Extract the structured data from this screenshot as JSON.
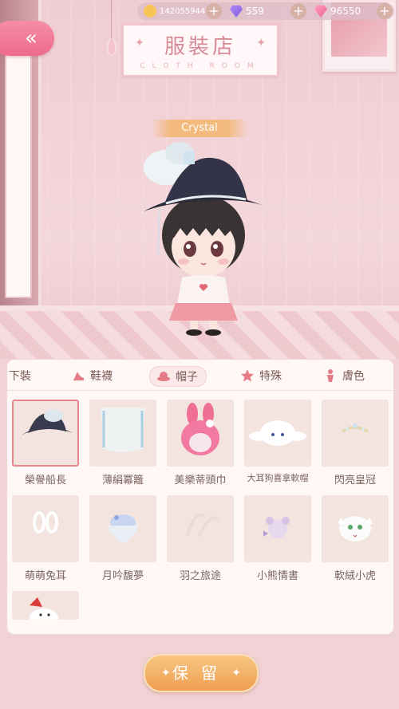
{
  "currency": {
    "coins": "142055944",
    "gems_purple": "559",
    "gems_pink": "96550",
    "plus_label": "+"
  },
  "back": {
    "label": "«"
  },
  "sign": {
    "title": "服裝店",
    "subtitle": "CLOTH ROOM"
  },
  "character": {
    "name": "Crystal"
  },
  "tabs": [
    {
      "label": "下裝"
    },
    {
      "label": "鞋襪"
    },
    {
      "label": "帽子"
    },
    {
      "label": "特殊"
    },
    {
      "label": "膚色"
    }
  ],
  "active_tab": "帽子",
  "items": [
    {
      "label": "榮譽船長",
      "selected": true
    },
    {
      "label": "薄絹冪籬"
    },
    {
      "label": "美樂蒂頭巾"
    },
    {
      "label": "大耳狗喜拿軟帽"
    },
    {
      "label": "閃亮皇冠"
    },
    {
      "label": "萌萌兔耳"
    },
    {
      "label": "月吟馥夢"
    },
    {
      "label": "羽之旅途"
    },
    {
      "label": "小熊情書"
    },
    {
      "label": "軟絨小虎"
    },
    {
      "label": ""
    }
  ],
  "save": {
    "label": "保留"
  },
  "colors": {
    "accent": "#ee6b8b",
    "save": "#ee9f52",
    "panel": "#fff8f6"
  }
}
